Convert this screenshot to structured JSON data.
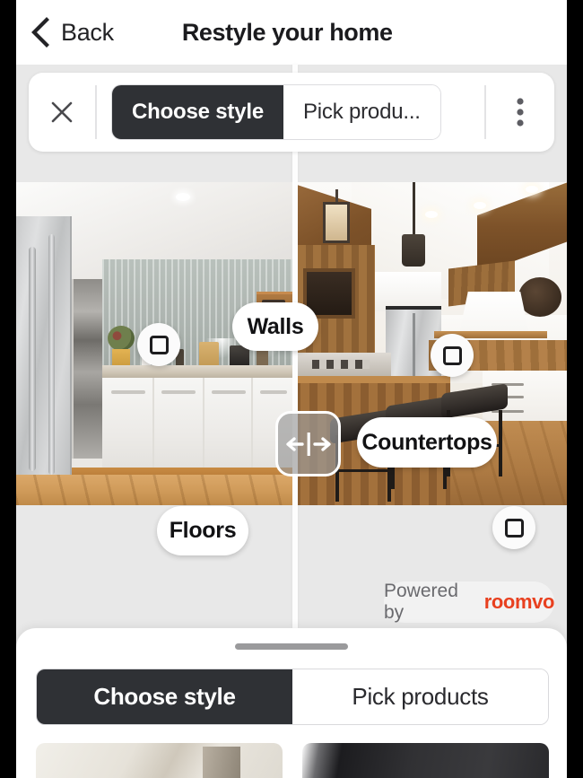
{
  "header": {
    "back_label": "Back",
    "title": "Restyle your home"
  },
  "toolbar": {
    "close_icon": "close-icon",
    "more_icon": "more-vertical-icon",
    "tabs": [
      {
        "label": "Choose style",
        "active": true
      },
      {
        "label": "Pick produ...",
        "active": false
      }
    ]
  },
  "visualizer": {
    "split_handle_icon": "left-right-arrows-icon",
    "pills": [
      {
        "label": "Walls"
      },
      {
        "label": "Countertops"
      },
      {
        "label": "Floors"
      }
    ],
    "markers": [
      {
        "name": "walls-marker",
        "icon": "square-outline-icon"
      },
      {
        "name": "upper-right-marker",
        "icon": "square-outline-icon"
      },
      {
        "name": "floor-marker",
        "icon": "square-outline-icon"
      }
    ],
    "powered_by": {
      "prefix": "Powered by",
      "brand": "roomvo",
      "brand_color": "#e8401f"
    }
  },
  "bottom_sheet": {
    "tabs": [
      {
        "label": "Choose style",
        "active": true
      },
      {
        "label": "Pick products",
        "active": false
      }
    ],
    "thumbnails": [
      {
        "name": "style-thumbnail-light"
      },
      {
        "name": "style-thumbnail-dark"
      }
    ]
  }
}
